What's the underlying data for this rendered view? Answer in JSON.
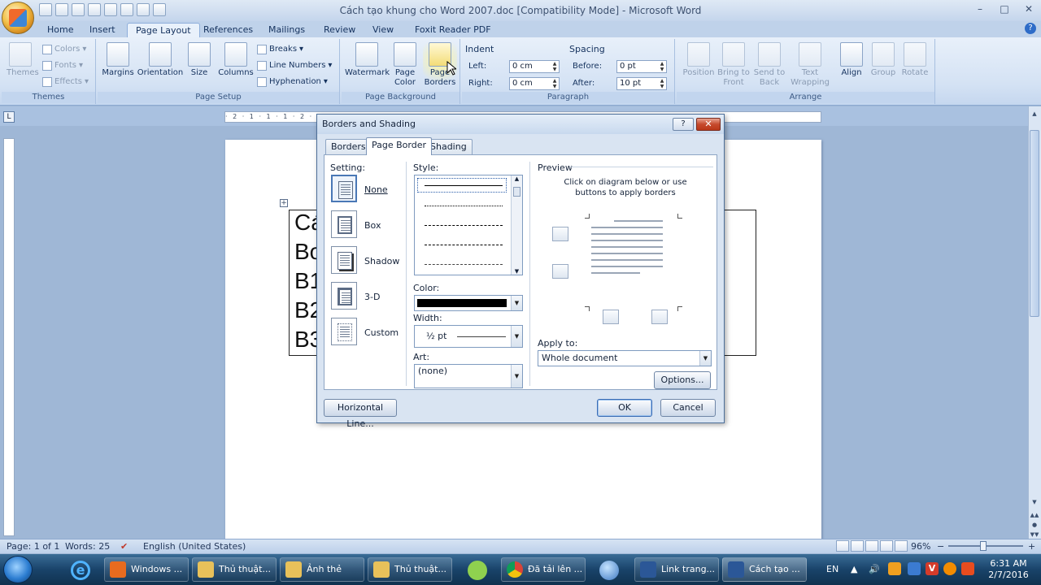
{
  "window": {
    "title": "Cách tạo khung cho Word 2007.doc [Compatibility Mode] - Microsoft Word",
    "minimize": "–",
    "maximize": "□",
    "close": "✕"
  },
  "ribbon_tabs": [
    "Home",
    "Insert",
    "Page Layout",
    "References",
    "Mailings",
    "Review",
    "View",
    "Foxit Reader PDF"
  ],
  "active_tab": "Page Layout",
  "ribbon": {
    "themes": {
      "label": "Themes",
      "themes_btn": "Themes",
      "colors": "Colors",
      "fonts": "Fonts",
      "effects": "Effects"
    },
    "page_setup": {
      "label": "Page Setup",
      "margins": "Margins",
      "orientation": "Orientation",
      "size": "Size",
      "columns": "Columns",
      "breaks": "Breaks",
      "line_numbers": "Line Numbers",
      "hyphenation": "Hyphenation"
    },
    "page_background": {
      "label": "Page Background",
      "watermark": "Watermark",
      "page_color_1": "Page",
      "page_color_2": "Color",
      "page_borders_1": "Page",
      "page_borders_2": "Borders"
    },
    "paragraph": {
      "label": "Paragraph",
      "indent_head": "Indent",
      "spacing_head": "Spacing",
      "left_label": "Left:",
      "left_value": "0 cm",
      "right_label": "Right:",
      "right_value": "0 cm",
      "before_label": "Before:",
      "before_value": "0 pt",
      "after_label": "After:",
      "after_value": "10 pt"
    },
    "arrange": {
      "label": "Arrange",
      "position": "Position",
      "bring_front_1": "Bring to",
      "bring_front_2": "Front",
      "send_back_1": "Send to",
      "send_back_2": "Back",
      "text_wrap_1": "Text",
      "text_wrap_2": "Wrapping",
      "align": "Align",
      "group": "Group",
      "rotate": "Rotate"
    }
  },
  "ruler_text": "· 2 · 1 · 1 · 1 · 2 · 3 · 4 · 5 · 6 · 7 · 8 · 9 · 10 · 11 · 12 · 13 · 14 · 15 · 16 · 17 · 18 · 19",
  "document": {
    "lines": [
      "Cá",
      "Bo",
      "B1",
      "B2",
      "B3"
    ]
  },
  "dialog": {
    "title": "Borders and Shading",
    "help": "?",
    "close": "✕",
    "tabs": [
      "Borders",
      "Page Border",
      "Shading"
    ],
    "active_tab": "Page Border",
    "setting_label": "Setting:",
    "settings": [
      "None",
      "Box",
      "Shadow",
      "3-D",
      "Custom"
    ],
    "selected_setting": "None",
    "style_label": "Style:",
    "color_label": "Color:",
    "color_value": "#000000",
    "width_label": "Width:",
    "width_value": "½ pt",
    "art_label": "Art:",
    "art_value": "(none)",
    "preview_label": "Preview",
    "preview_hint_1": "Click on diagram below or use",
    "preview_hint_2": "buttons to apply borders",
    "apply_to_label": "Apply to:",
    "apply_to_value": "Whole document",
    "options_btn": "Options...",
    "horizontal_line_btn": "Horizontal Line...",
    "ok_btn": "OK",
    "cancel_btn": "Cancel"
  },
  "statusbar": {
    "page": "Page: 1 of 1",
    "words": "Words: 25",
    "language": "English (United States)",
    "zoom": "96%",
    "zoom_out": "−",
    "zoom_in": "+"
  },
  "taskbar": {
    "items": [
      "Windows ...",
      "Thủ thuật...",
      "Ảnh thẻ",
      "Thủ thuật...",
      "Đã tải lên ...",
      "Link trang...",
      "Cách tạo ..."
    ],
    "language": "EN",
    "time": "6:31 AM",
    "date": "2/7/2016"
  }
}
